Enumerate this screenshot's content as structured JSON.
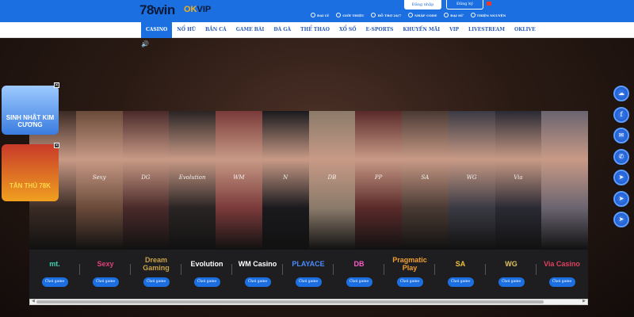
{
  "header": {
    "logo": "78win",
    "partner_logo": "OKVIP",
    "login": "Đăng nhập",
    "register": "Đăng ký",
    "links": [
      "ĐẠI LÝ",
      "GIỚI THIỆU",
      "HỖ TRỢ 24/7",
      "NHẬP CODE",
      "ĐẠI SỨ",
      "THIỆN NGUYỆN"
    ]
  },
  "nav": [
    "CASINO",
    "NỔ HŨ",
    "BẮN CÁ",
    "GAME BÀI",
    "ĐÁ GÀ",
    "THỂ THAO",
    "XỔ SỐ",
    "E-SPORTS",
    "KHUYẾN MÃI",
    "VIP",
    "LIVESTREAM",
    "OKLIVE"
  ],
  "promos": {
    "first": "SINH NHẬT KIM CƯƠNG",
    "second": "TÂN THỦ 78K"
  },
  "gallery_marks": [
    "",
    "Sexy",
    "DG",
    "Evolution",
    "WM",
    "N",
    "DB",
    "PP",
    "SA",
    "WG",
    "Via",
    ""
  ],
  "providers": [
    {
      "name": "mt.",
      "color": "#3fd0b0"
    },
    {
      "name": "Sexy",
      "color": "#e0407a"
    },
    {
      "name": "Dream Gaming",
      "color": "#c9a24a"
    },
    {
      "name": "Evolution",
      "color": "#ffffff"
    },
    {
      "name": "WM Casino",
      "color": "#ffffff"
    },
    {
      "name": "PLAYACE",
      "color": "#4a8cff"
    },
    {
      "name": "DB",
      "color": "#ff5ac8"
    },
    {
      "name": "Pragmatic Play",
      "color": "#f0a030"
    },
    {
      "name": "SA",
      "color": "#f0c040"
    },
    {
      "name": "WG",
      "color": "#e0c060"
    },
    {
      "name": "Via Casino",
      "color": "#e04060"
    }
  ],
  "play_label": "Chơi game",
  "side_icons": [
    "chat-icon",
    "facebook-icon",
    "mail-icon",
    "messenger-icon",
    "telegram-icon",
    "telegram-icon",
    "telegram-icon"
  ]
}
